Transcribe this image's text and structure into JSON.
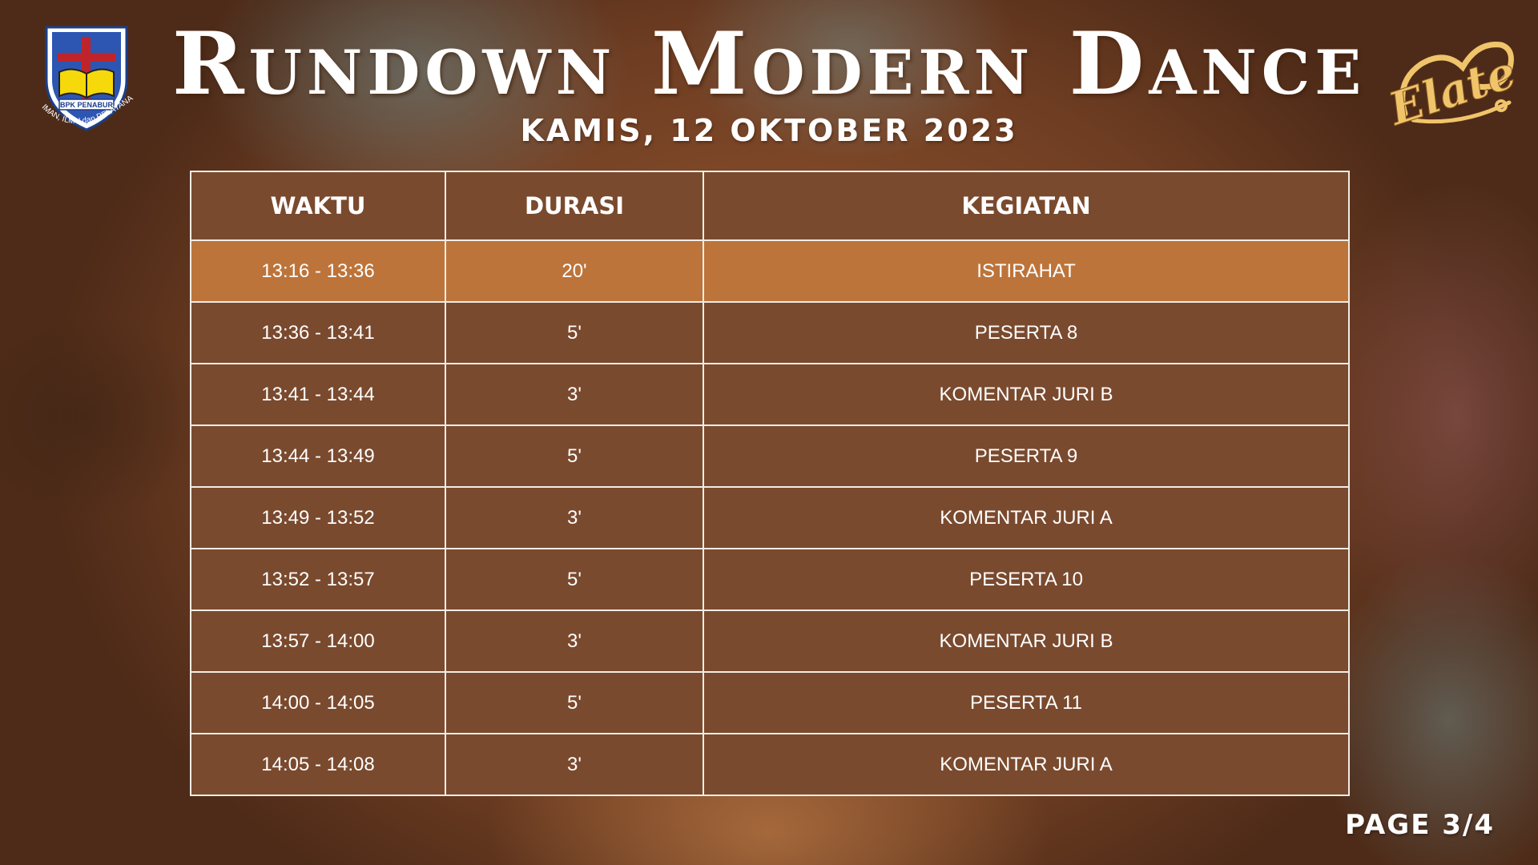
{
  "header": {
    "title": "Rundown Modern Dance",
    "subtitle": "KAMIS, 12 OKTOBER 2023"
  },
  "logo_left": {
    "badge_text": "BPK PENABUR",
    "motto": "IMAN, ILMU dan PELAYANAN",
    "icon": "shield-cross-book-icon"
  },
  "logo_right": {
    "text": "Elate",
    "icon": "elate-script-logo"
  },
  "table": {
    "columns": [
      "WAKTU",
      "DURASI",
      "KEGIATAN"
    ],
    "rows": [
      {
        "waktu": "13:16 - 13:36",
        "durasi": "20'",
        "kegiatan": "ISTIRAHAT",
        "highlight": true
      },
      {
        "waktu": "13:36 - 13:41",
        "durasi": "5'",
        "kegiatan": "PESERTA 8"
      },
      {
        "waktu": "13:41 - 13:44",
        "durasi": "3'",
        "kegiatan": "KOMENTAR JURI B"
      },
      {
        "waktu": "13:44 - 13:49",
        "durasi": "5'",
        "kegiatan": "PESERTA 9"
      },
      {
        "waktu": "13:49 - 13:52",
        "durasi": "3'",
        "kegiatan": "KOMENTAR JURI A"
      },
      {
        "waktu": "13:52 - 13:57",
        "durasi": "5'",
        "kegiatan": "PESERTA 10"
      },
      {
        "waktu": "13:57 - 14:00",
        "durasi": "3'",
        "kegiatan": "KOMENTAR JURI B"
      },
      {
        "waktu": "14:00 - 14:05",
        "durasi": "5'",
        "kegiatan": "PESERTA 11"
      },
      {
        "waktu": "14:05 - 14:08",
        "durasi": "3'",
        "kegiatan": "KOMENTAR JURI A"
      }
    ]
  },
  "page": {
    "label": "PAGE 3/4"
  },
  "colors": {
    "cell_background": "#7a4a2e",
    "highlight_background": "#bd743a",
    "border": "#f2ece6",
    "text": "#ffffff",
    "logo_gold": "#f0c46a"
  }
}
